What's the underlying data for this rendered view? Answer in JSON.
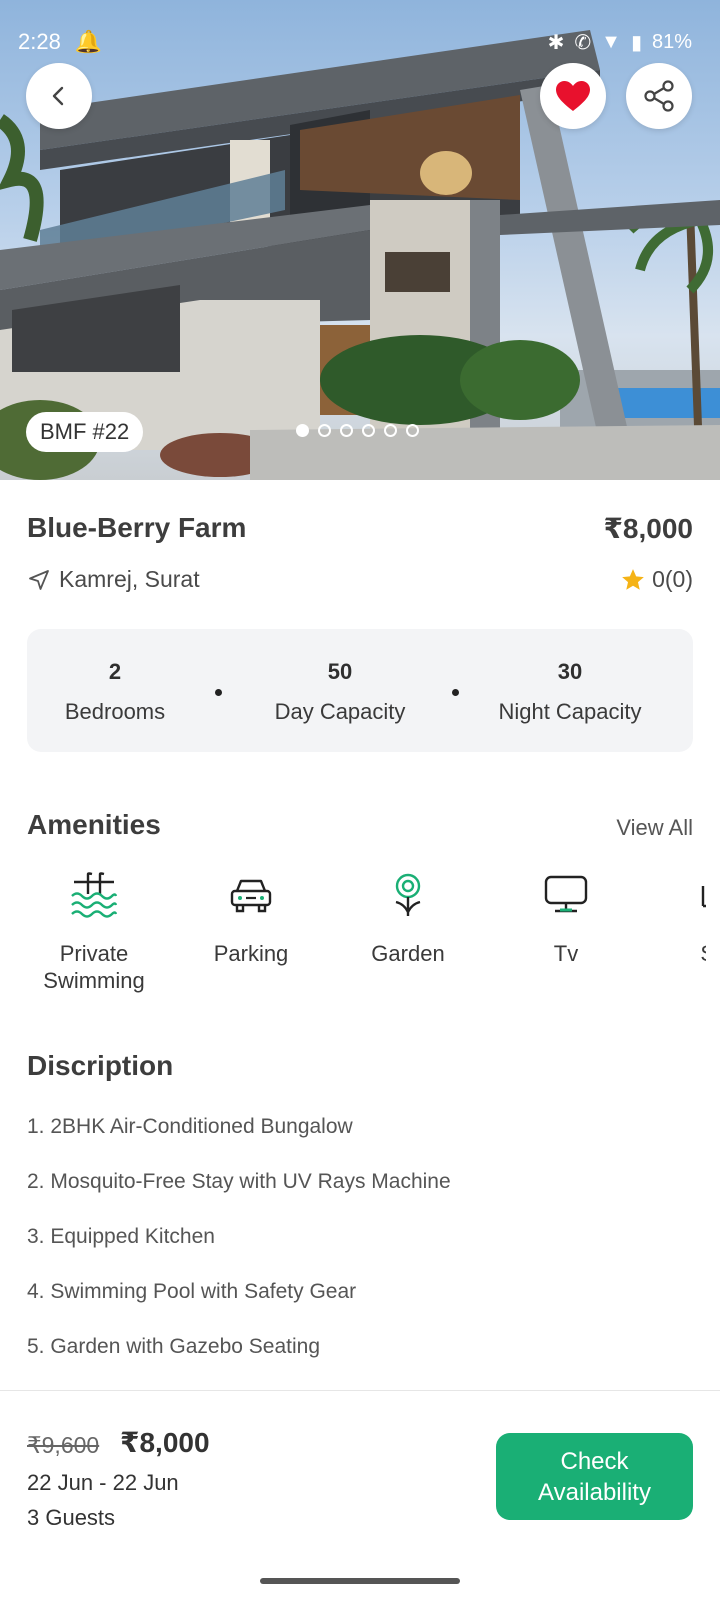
{
  "status_bar": {
    "time": "2:28",
    "battery": "81%",
    "icons": [
      "notification-bell-icon",
      "bluetooth-icon",
      "wifi-call-icon",
      "signal-icon",
      "battery-icon"
    ]
  },
  "hero": {
    "code": "BMF #22",
    "image_count": 6,
    "active_image": 1,
    "icons": {
      "back": "chevron-left-icon",
      "favorite": "heart-icon",
      "share": "share-icon"
    }
  },
  "property": {
    "name": "Blue-Berry Farm",
    "price": "₹8,000",
    "location": "Kamrej, Surat",
    "rating": "0(0)"
  },
  "stats": [
    {
      "value": "2",
      "label": "Bedrooms"
    },
    {
      "value": "50",
      "label": "Day Capacity"
    },
    {
      "value": "30",
      "label": "Night Capacity"
    }
  ],
  "amenities": {
    "title": "Amenities",
    "view_all": "View All",
    "items": [
      {
        "label": "Private Swimming",
        "icon": "swimming-pool-icon"
      },
      {
        "label": "Parking",
        "icon": "car-icon"
      },
      {
        "label": "Garden",
        "icon": "flower-icon"
      },
      {
        "label": "Tv",
        "icon": "tv-icon"
      },
      {
        "label": "Sofa",
        "icon": "sofa-icon"
      }
    ]
  },
  "description": {
    "title": "Discription",
    "items": [
      "1. 2BHK Air-Conditioned Bungalow",
      "2. Mosquito-Free Stay with UV Rays Machine",
      "3. Equipped Kitchen",
      "4. Swimming Pool with Safety Gear",
      "5. Garden with Gazebo Seating"
    ]
  },
  "booking": {
    "original_price": "₹9,600",
    "price": "₹8,000",
    "dates": "22 Jun - 22 Jun",
    "guests": "3 Guests",
    "button": "Check Availability"
  },
  "colors": {
    "accent": "#1aaf75",
    "heart": "#e8112d",
    "star": "#f5b316",
    "stats_bg": "#f3f4f6"
  }
}
